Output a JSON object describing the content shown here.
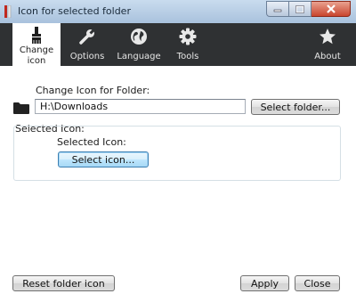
{
  "window": {
    "title": "Icon for selected folder"
  },
  "ribbon": {
    "tabs": [
      {
        "id": "change-icon",
        "label_line1": "Change",
        "label_line2": "icon",
        "icon": "brush-icon",
        "active": true
      },
      {
        "id": "options",
        "label": "Options",
        "icon": "wrench-icon"
      },
      {
        "id": "language",
        "label": "Language",
        "icon": "globe-icon"
      },
      {
        "id": "tools",
        "label": "Tools",
        "icon": "gear-icon"
      },
      {
        "id": "about",
        "label": "About",
        "icon": "star-icon"
      }
    ]
  },
  "main": {
    "change_icon_label": "Change Icon for Folder:",
    "folder_path": "H:\\Downloads",
    "select_folder_button": "Select folder...",
    "selected_icon_group_label": "Selected Icon:",
    "selected_icon_label": "Selected Icon:",
    "select_icon_button": "Select icon..."
  },
  "footer": {
    "reset_button": "Reset folder icon",
    "apply_button": "Apply",
    "close_button": "Close"
  }
}
